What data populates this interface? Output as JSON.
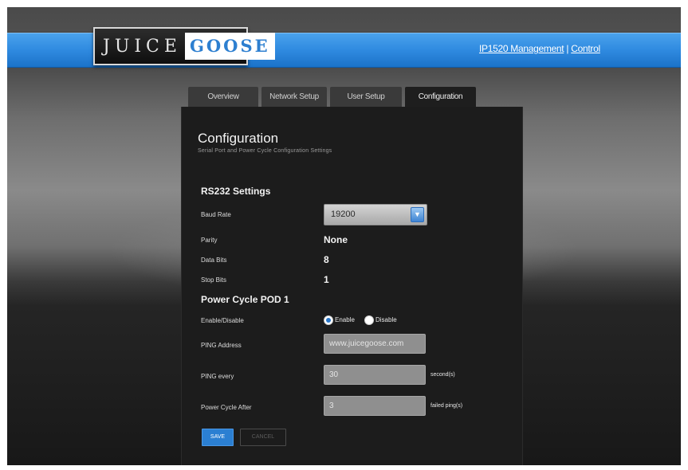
{
  "header": {
    "logo": {
      "word1": "JUICE",
      "word2": "GOOSE"
    },
    "management_link": "IP1520 Management",
    "separator": "|",
    "control_link": "Control"
  },
  "tabs": [
    {
      "label": "Overview",
      "active": false
    },
    {
      "label": "Network Setup",
      "active": false
    },
    {
      "label": "User Setup",
      "active": false
    },
    {
      "label": "Configuration",
      "active": true
    }
  ],
  "panel": {
    "title": "Configuration",
    "subtitle": "Serial Port and Power Cycle Configuration Settings"
  },
  "rs232": {
    "heading": "RS232 Settings",
    "baud_rate_label": "Baud Rate",
    "baud_rate_value": "19200",
    "parity_label": "Parity",
    "parity_value": "None",
    "data_bits_label": "Data Bits",
    "data_bits_value": "8",
    "stop_bits_label": "Stop Bits",
    "stop_bits_value": "1"
  },
  "power_cycle": {
    "heading": "Power Cycle POD 1",
    "enable_label": "Enable/Disable",
    "enable_option": "Enable",
    "disable_option": "Disable",
    "selected": "Enable",
    "ping_address_label": "PING Address",
    "ping_address_value": "www.juicegoose.com",
    "ping_every_label": "PING every",
    "ping_every_value": "30",
    "ping_every_unit": "second(s)",
    "power_cycle_after_label": "Power Cycle After",
    "power_cycle_after_value": "3",
    "power_cycle_after_unit": "failed ping(s)"
  },
  "buttons": {
    "save": "SAVE",
    "cancel": "CANCEL"
  },
  "colors": {
    "accent_blue": "#2b7fd2",
    "panel_bg": "#1c1c1c",
    "topbar_blue": "#2f8ae0"
  }
}
